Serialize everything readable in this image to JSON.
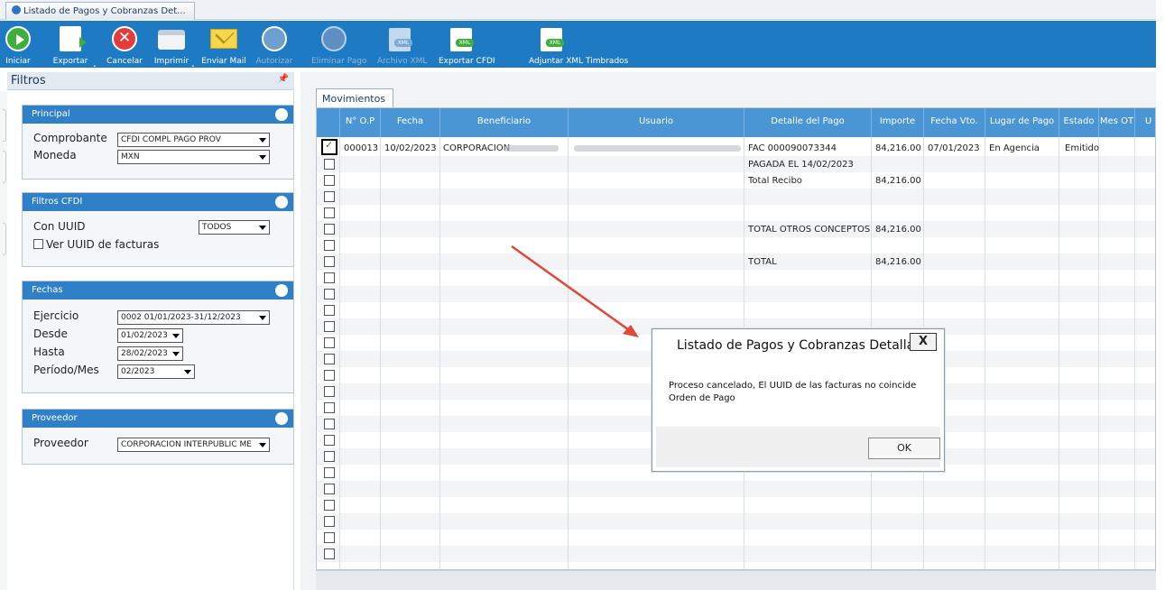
{
  "window": {
    "tab_title": "Listado de Pagos y Cobranzas Det..."
  },
  "toolbar": {
    "items": [
      {
        "label": "Iniciar",
        "icon": "play-icon",
        "enabled": true
      },
      {
        "label": "Exportar",
        "icon": "export-icon",
        "enabled": true
      },
      {
        "label": "Cancelar",
        "icon": "cancel-icon",
        "enabled": true
      },
      {
        "label": "Imprimir",
        "icon": "printer-icon",
        "enabled": true
      },
      {
        "label": "Enviar Mail",
        "icon": "mail-icon",
        "enabled": true
      },
      {
        "label": "Autorizar",
        "icon": "authorize-icon",
        "enabled": false
      },
      {
        "label": "Eliminar Pago",
        "icon": "delete-payment-icon",
        "enabled": false
      },
      {
        "label": "Archivo XML",
        "icon": "xml-file-icon",
        "enabled": false
      },
      {
        "label": "Exportar CFDI",
        "icon": "export-cfdi-icon",
        "enabled": true
      },
      {
        "label": "Adjuntar XML Timbrados",
        "icon": "attach-xml-icon",
        "enabled": true
      }
    ],
    "colors": {
      "background": "#1e7ac3",
      "disabled_text": "#8fb7dd"
    }
  },
  "filters": {
    "title": "Filtros",
    "principal": {
      "header": "Principal",
      "comprobante_label": "Comprobante",
      "comprobante_value": "CFDI COMPL PAGO PROV",
      "moneda_label": "Moneda",
      "moneda_value": "MXN"
    },
    "cfdi": {
      "header": "Filtros CFDI",
      "uuid_label": "Con UUID",
      "uuid_value": "TODOS",
      "ver_uuid_label": "Ver UUID de facturas"
    },
    "fechas": {
      "header": "Fechas",
      "ejercicio_label": "Ejercicio",
      "ejercicio_value": "0002 01/01/2023-31/12/2023",
      "desde_label": "Desde",
      "desde_value": "01/02/2023",
      "hasta_label": "Hasta",
      "hasta_value": "28/02/2023",
      "periodo_label": "Período/Mes",
      "periodo_value": "02/2023"
    },
    "proveedor": {
      "header": "Proveedor",
      "label": "Proveedor",
      "value": "CORPORACION INTERPUBLIC ME"
    }
  },
  "grid": {
    "tab_label": "Movimientos",
    "columns": [
      "N° O.P",
      "Fecha",
      "Beneficiario",
      "Usuario",
      "Detalle del Pago",
      "Importe",
      "Fecha Vto.",
      "Lugar de Pago",
      "Estado",
      "Mes OT",
      "U"
    ],
    "rows": [
      {
        "checked": true,
        "op": "000013",
        "fecha": "10/02/2023",
        "beneficiario": "CORPORACION",
        "detalle": "FAC 000090073344",
        "importe": "84,216.00",
        "vto": "07/01/2023",
        "lugar": "En Agencia",
        "estado": "Emitido"
      },
      {
        "detalle": "PAGADA EL 14/02/2023"
      },
      {
        "detalle": "Total Recibo",
        "importe": "84,216.00"
      },
      {},
      {},
      {
        "detalle": "TOTAL OTROS CONCEPTOS",
        "importe": "84,216.00"
      },
      {},
      {
        "detalle": "TOTAL",
        "importe": "84,216.00"
      },
      {},
      {},
      {},
      {},
      {},
      {},
      {},
      {},
      {},
      {},
      {},
      {},
      {},
      {},
      {},
      {},
      {},
      {}
    ],
    "header_color": "#4a95d3"
  },
  "dialog": {
    "title": "Listado de Pagos y Cobranzas Detallado",
    "close_label": "X",
    "message_line1": "Proceso cancelado, El UUID de las facturas no coincide",
    "message_line2": "Orden de Pago",
    "ok_label": "OK"
  },
  "annotation": {
    "arrow_color": "#e2473b"
  }
}
